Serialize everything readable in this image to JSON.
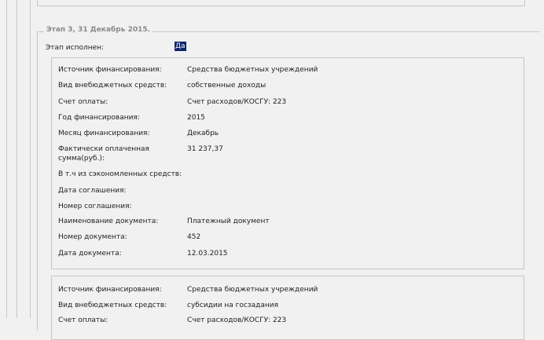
{
  "stage": {
    "legend": "Этап 3, 31 Декабрь 2015.",
    "status_label": "Этап исполнен:",
    "status_value": "Да"
  },
  "card1": {
    "rows": [
      {
        "label": "Источник финансирования:",
        "value": "Средства бюджетных учреждений"
      },
      {
        "label": "Вид внебюджетных средств:",
        "value": "собственные доходы"
      },
      {
        "label": "Счет оплаты:",
        "value": "Счет расходов/КОСГУ: 223"
      },
      {
        "label": "Год финансирования:",
        "value": "2015"
      },
      {
        "label": "Месяц финансирования:",
        "value": "Декабрь"
      },
      {
        "label": "Фактически оплаченная сумма(руб.):",
        "value": "31 237,37"
      },
      {
        "label": "В т.ч из сэкономленных средств:",
        "value": ""
      },
      {
        "label": "Дата соглашения:",
        "value": ""
      },
      {
        "label": "Номер соглашения:",
        "value": ""
      },
      {
        "label": "Наименование документа:",
        "value": "Платежный документ"
      },
      {
        "label": "Номер документа:",
        "value": "452"
      },
      {
        "label": "Дата документа:",
        "value": "12.03.2015"
      }
    ]
  },
  "card2": {
    "rows": [
      {
        "label": "Источник финансирования:",
        "value": "Средства бюджетных учреждений"
      },
      {
        "label": "Вид внебюджетных средств:",
        "value": "субсидии на госзадания"
      },
      {
        "label": "Счет оплаты:",
        "value": "Счет расходов/КОСГУ: 223"
      }
    ]
  }
}
